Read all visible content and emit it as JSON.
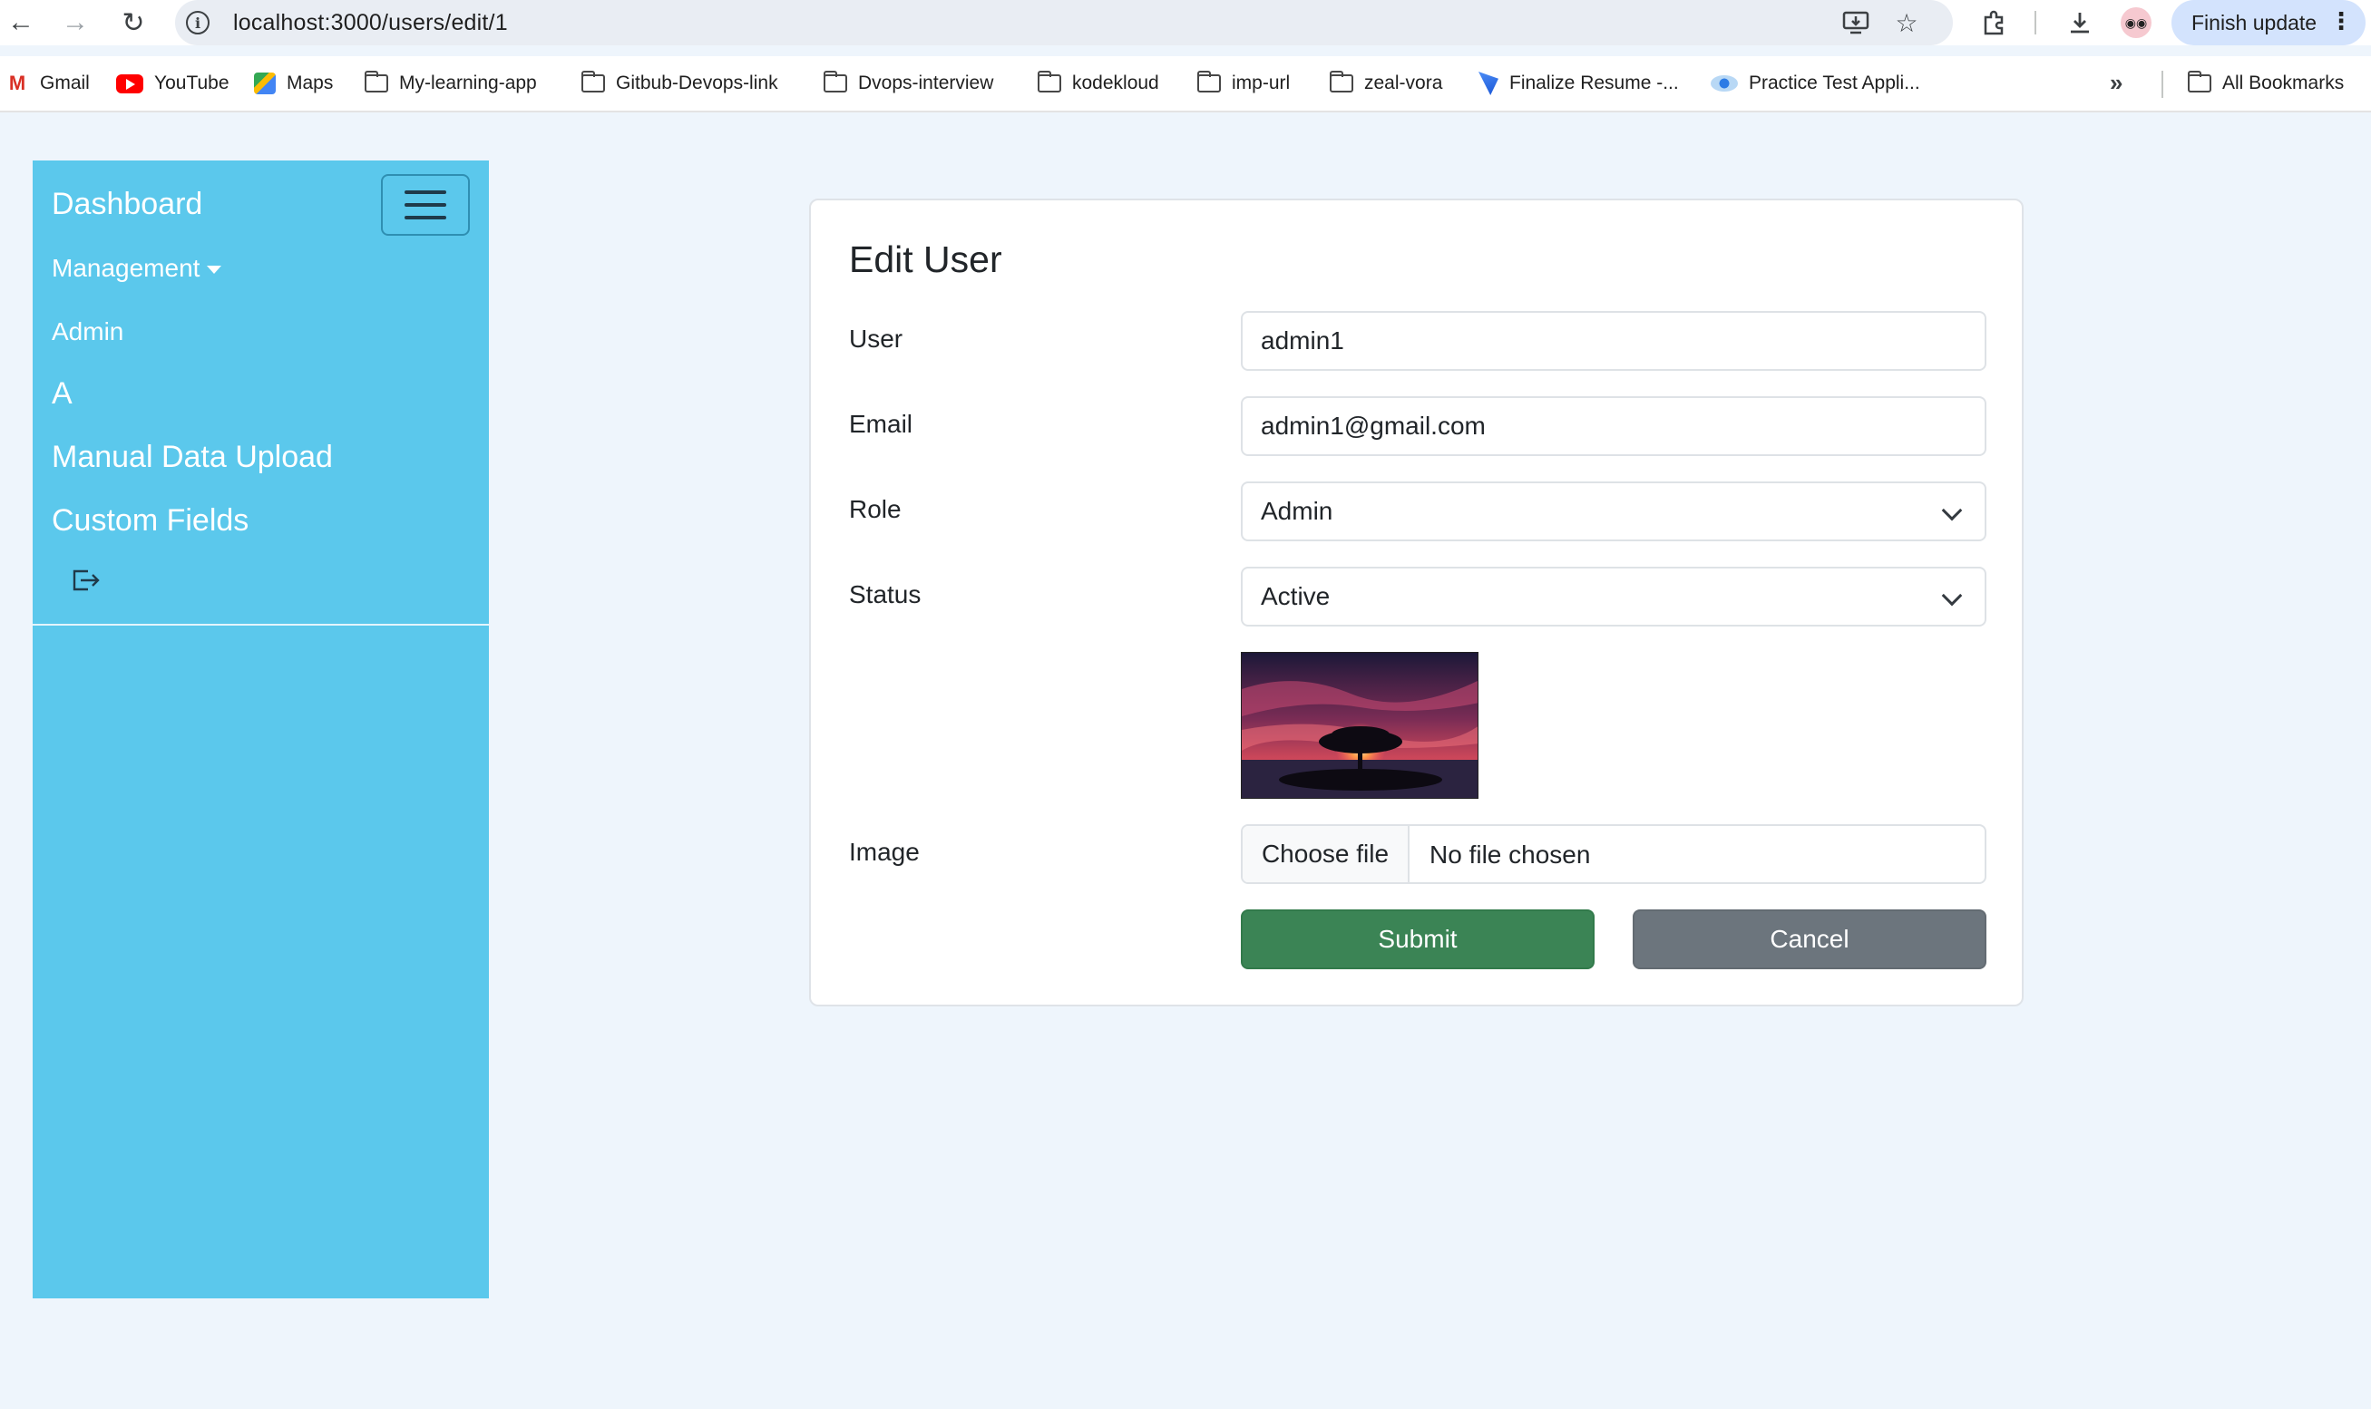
{
  "browser": {
    "url": "localhost:3000/users/edit/1",
    "finish_update": "Finish update",
    "bookmarks": [
      {
        "label": "Gmail",
        "icon": "gmail-icon"
      },
      {
        "label": "YouTube",
        "icon": "youtube-icon"
      },
      {
        "label": "Maps",
        "icon": "maps-icon"
      },
      {
        "label": "My-learning-app",
        "icon": "folder-icon"
      },
      {
        "label": "Gitbub-Devops-link",
        "icon": "folder-icon"
      },
      {
        "label": "Dvops-interview",
        "icon": "folder-icon"
      },
      {
        "label": "kodekloud",
        "icon": "folder-icon"
      },
      {
        "label": "imp-url",
        "icon": "folder-icon"
      },
      {
        "label": "zeal-vora",
        "icon": "folder-icon"
      },
      {
        "label": "Finalize Resume -...",
        "icon": "site-icon"
      },
      {
        "label": "Practice Test Appli...",
        "icon": "site-icon"
      }
    ],
    "all_bookmarks": "All Bookmarks"
  },
  "sidebar": {
    "brand": "Dashboard",
    "items": [
      {
        "label": "Management",
        "dropdown": true
      },
      {
        "label": "Admin"
      },
      {
        "label": "A"
      },
      {
        "label": "Manual Data Upload"
      },
      {
        "label": "Custom Fields"
      }
    ],
    "logout_icon": "logout-icon",
    "background_color": "#5bc8ec"
  },
  "form": {
    "title": "Edit User",
    "user": {
      "label": "User",
      "value": "admin1"
    },
    "email": {
      "label": "Email",
      "value": "admin1@gmail.com"
    },
    "role": {
      "label": "Role",
      "value": "Admin"
    },
    "status": {
      "label": "Status",
      "value": "Active"
    },
    "image": {
      "label": "Image",
      "button": "Choose file",
      "file_status": "No file chosen"
    },
    "submit": "Submit",
    "cancel": "Cancel",
    "colors": {
      "submit": "#3b8455",
      "cancel": "#6c757d"
    }
  }
}
